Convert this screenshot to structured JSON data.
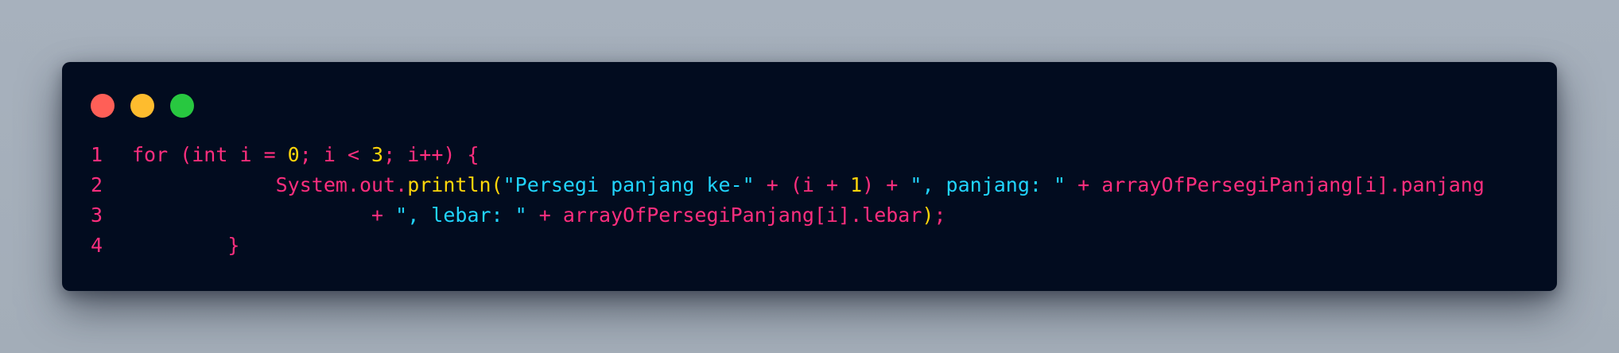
{
  "window": {
    "background": "#020c1f",
    "buttons": [
      {
        "name": "close",
        "color": "#ff5f57"
      },
      {
        "name": "minimize",
        "color": "#febc2e"
      },
      {
        "name": "maximize",
        "color": "#28c840"
      }
    ]
  },
  "colors": {
    "line_number": "#ff2e7e",
    "keyword": "#ff2e7e",
    "identifier": "#ff2e7e",
    "punctuation": "#ff2e7e",
    "number": "#ffd60a",
    "method": "#ffd60a",
    "paren_method": "#ffd60a",
    "string": "#21d4fd"
  },
  "code": {
    "lines": [
      {
        "number": "1",
        "tokens": [
          {
            "text": "for (int i = ",
            "kind": "keyword"
          },
          {
            "text": "0",
            "kind": "number"
          },
          {
            "text": "; i < ",
            "kind": "keyword"
          },
          {
            "text": "3",
            "kind": "number"
          },
          {
            "text": "; i++) {",
            "kind": "keyword"
          }
        ]
      },
      {
        "number": "2",
        "tokens": [
          {
            "text": "            System.out.",
            "kind": "identifier"
          },
          {
            "text": "println",
            "kind": "method"
          },
          {
            "text": "(",
            "kind": "paren_method"
          },
          {
            "text": "\"Persegi panjang ke-\"",
            "kind": "string"
          },
          {
            "text": " + (i + ",
            "kind": "punctuation"
          },
          {
            "text": "1",
            "kind": "number"
          },
          {
            "text": ") + ",
            "kind": "punctuation"
          },
          {
            "text": "\", panjang: \"",
            "kind": "string"
          },
          {
            "text": " + arrayOfPersegiPanjang[i].panjang",
            "kind": "identifier"
          }
        ]
      },
      {
        "number": "3",
        "tokens": [
          {
            "text": "                    + ",
            "kind": "punctuation"
          },
          {
            "text": "\", lebar: \"",
            "kind": "string"
          },
          {
            "text": " + arrayOfPersegiPanjang[i].lebar",
            "kind": "identifier"
          },
          {
            "text": ")",
            "kind": "paren_method"
          },
          {
            "text": ";",
            "kind": "punctuation"
          }
        ]
      },
      {
        "number": "4",
        "tokens": [
          {
            "text": "        }",
            "kind": "punctuation"
          }
        ]
      }
    ]
  }
}
